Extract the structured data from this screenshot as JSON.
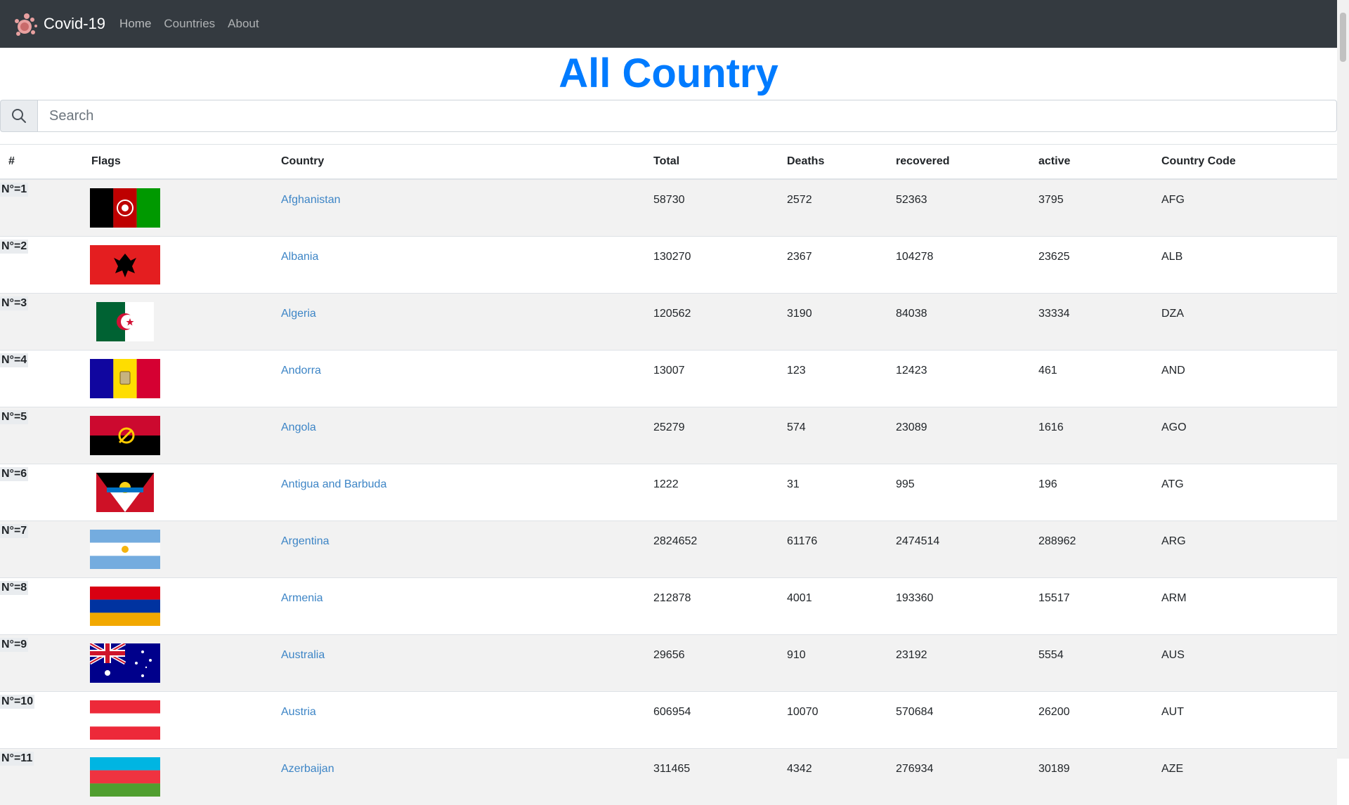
{
  "navbar": {
    "brand": "Covid-19",
    "links": [
      "Home",
      "Countries",
      "About"
    ],
    "logo_icon": "virus-icon"
  },
  "page": {
    "title": "All Country",
    "search_placeholder": "Search",
    "search_icon": "search-icon"
  },
  "colors": {
    "navbar_bg": "#343a40",
    "title": "#007bff",
    "link": "#3d85c6",
    "stripe": "#f2f2f2"
  },
  "table": {
    "headers": [
      "#",
      "Flags",
      "Country",
      "Total",
      "Deaths",
      "recovered",
      "active",
      "Country Code"
    ],
    "rows": [
      {
        "num": "N°=1",
        "country": "Afghanistan",
        "total": "58730",
        "deaths": "2572",
        "recovered": "52363",
        "active": "3795",
        "code": "AFG",
        "flag": "afghanistan-flag"
      },
      {
        "num": "N°=2",
        "country": "Albania",
        "total": "130270",
        "deaths": "2367",
        "recovered": "104278",
        "active": "23625",
        "code": "ALB",
        "flag": "albania-flag"
      },
      {
        "num": "N°=3",
        "country": "Algeria",
        "total": "120562",
        "deaths": "3190",
        "recovered": "84038",
        "active": "33334",
        "code": "DZA",
        "flag": "algeria-flag"
      },
      {
        "num": "N°=4",
        "country": "Andorra",
        "total": "13007",
        "deaths": "123",
        "recovered": "12423",
        "active": "461",
        "code": "AND",
        "flag": "andorra-flag"
      },
      {
        "num": "N°=5",
        "country": "Angola",
        "total": "25279",
        "deaths": "574",
        "recovered": "23089",
        "active": "1616",
        "code": "AGO",
        "flag": "angola-flag"
      },
      {
        "num": "N°=6",
        "country": "Antigua and Barbuda",
        "total": "1222",
        "deaths": "31",
        "recovered": "995",
        "active": "196",
        "code": "ATG",
        "flag": "antigua-flag"
      },
      {
        "num": "N°=7",
        "country": "Argentina",
        "total": "2824652",
        "deaths": "61176",
        "recovered": "2474514",
        "active": "288962",
        "code": "ARG",
        "flag": "argentina-flag"
      },
      {
        "num": "N°=8",
        "country": "Armenia",
        "total": "212878",
        "deaths": "4001",
        "recovered": "193360",
        "active": "15517",
        "code": "ARM",
        "flag": "armenia-flag"
      },
      {
        "num": "N°=9",
        "country": "Australia",
        "total": "29656",
        "deaths": "910",
        "recovered": "23192",
        "active": "5554",
        "code": "AUS",
        "flag": "australia-flag"
      },
      {
        "num": "N°=10",
        "country": "Austria",
        "total": "606954",
        "deaths": "10070",
        "recovered": "570684",
        "active": "26200",
        "code": "AUT",
        "flag": "austria-flag"
      },
      {
        "num": "N°=11",
        "country": "Azerbaijan",
        "total": "311465",
        "deaths": "4342",
        "recovered": "276934",
        "active": "30189",
        "code": "AZE",
        "flag": "azerbaijan-flag"
      }
    ]
  }
}
